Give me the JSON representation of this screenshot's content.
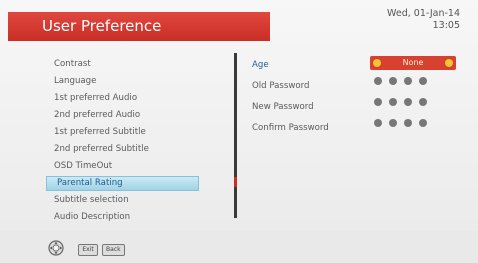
{
  "header": {
    "title": "User Preference"
  },
  "datetime": {
    "date": "Wed, 01-Jan-14",
    "time": "13:05"
  },
  "menu": {
    "items": [
      {
        "label": "Contrast"
      },
      {
        "label": "Language"
      },
      {
        "label": "1st preferred Audio"
      },
      {
        "label": "2nd preferred Audio"
      },
      {
        "label": "1st preferred Subtitle"
      },
      {
        "label": "2nd preferred Subtitle"
      },
      {
        "label": "OSD TimeOut"
      },
      {
        "label": "Parental Rating",
        "selected": true
      },
      {
        "label": "Subtitle selection"
      },
      {
        "label": "Audio Description"
      }
    ]
  },
  "parental": {
    "age_label": "Age",
    "age_value": "None",
    "old_password_label": "Old Password",
    "new_password_label": "New Password",
    "confirm_password_label": "Confirm Password",
    "pin_length": 4
  },
  "footer": {
    "exit_key": "Exit",
    "back_key": "Back"
  },
  "colors": {
    "accent": "#c92e27",
    "highlight": "#9fd3e6",
    "active_text": "#1f5c94"
  }
}
